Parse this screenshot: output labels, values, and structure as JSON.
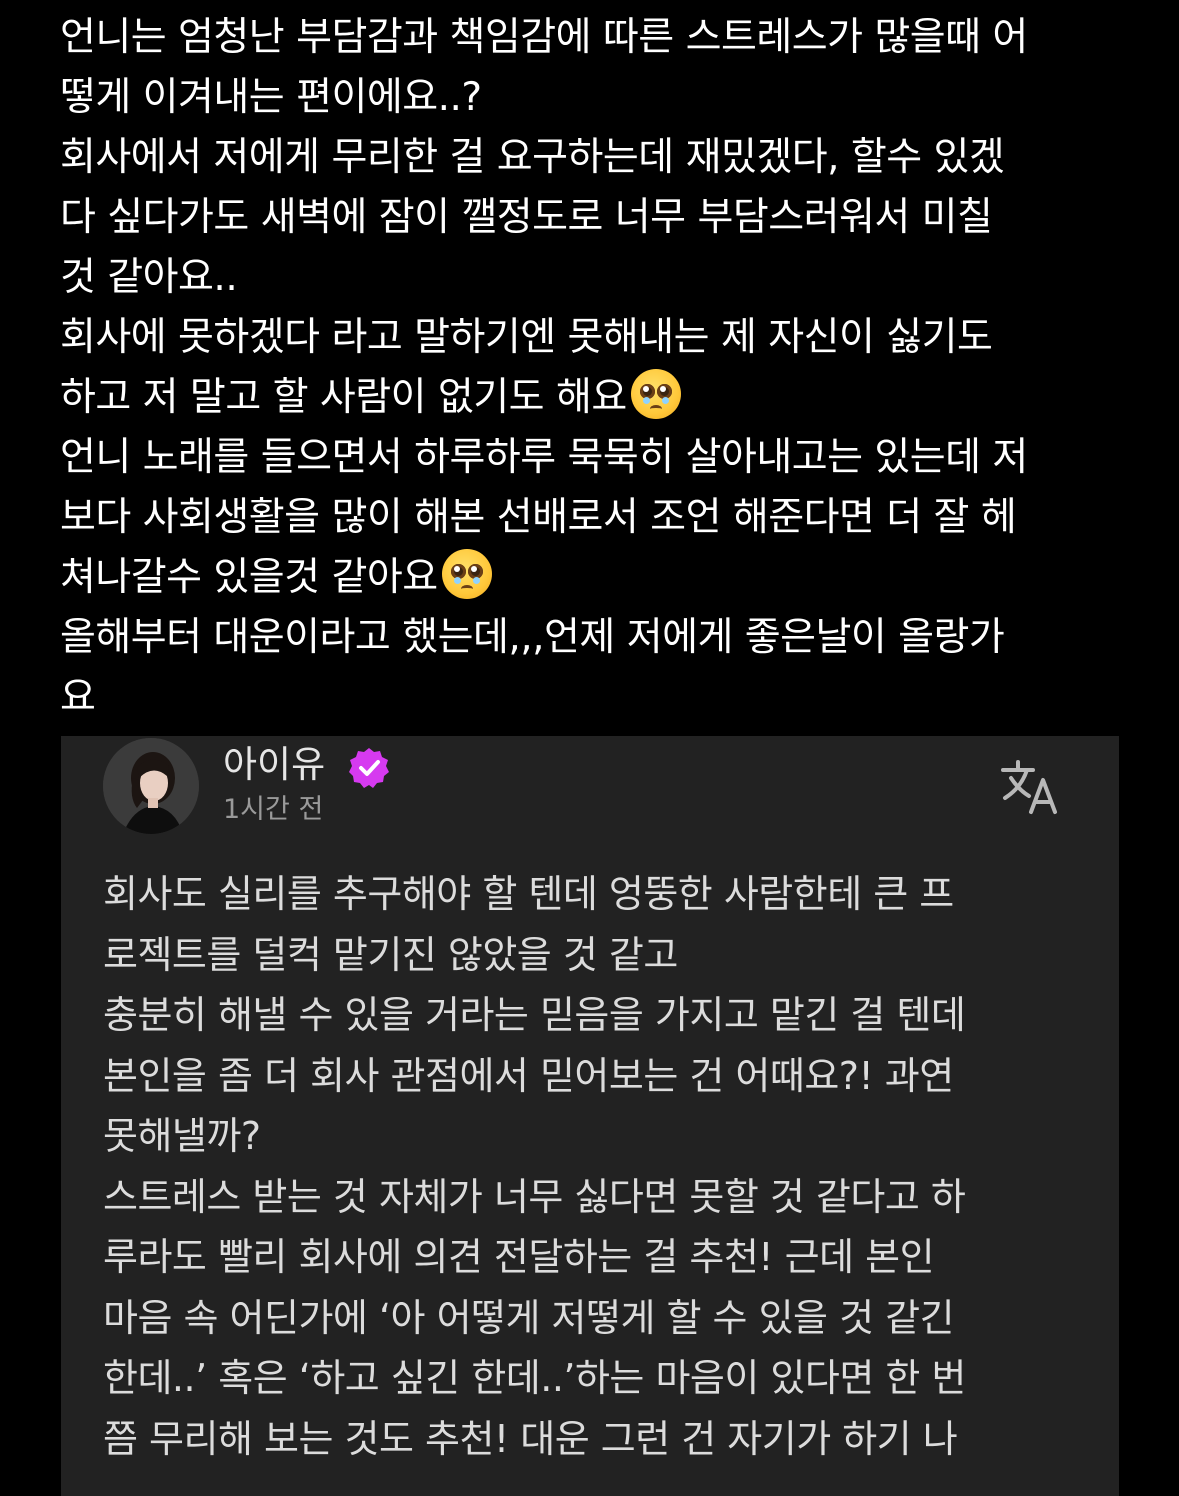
{
  "question": {
    "line1": "언니는 엄청난 부담감과 책임감에 따른 스트레스가 많을때 어",
    "line2": "떻게 이겨내는 편이에요..?",
    "line3": "회사에서 저에게 무리한 걸 요구하는데 재밌겠다, 할수 있겠",
    "line4": "다 싶다가도 새벽에 잠이 깰정도로 너무 부담스러워서 미칠",
    "line5": "것 같아요..",
    "line6": "회사에 못하겠다 라고 말하기엔 못해내는 제 자신이 싫기도",
    "line7": "하고 저 말고 할 사람이 없기도 해요",
    "line8": "언니 노래를 들으면서 하루하루 묵묵히 살아내고는 있는데 저",
    "line9": "보다 사회생활을 많이 해본 선배로서 조언 해준다면 더 잘 헤",
    "line10": "쳐나갈수 있을것 같아요",
    "line11": "올해부터 대운이라고 했는데,,,언제 저에게 좋은날이 올랑가",
    "line12": "요",
    "emoji_icon": "pleading-face-emoji"
  },
  "reply": {
    "username": "아이유",
    "timestamp": "1시간 전",
    "verified_color": "#d63af0",
    "translate_icon": "translate-icon",
    "body": {
      "line1": "회사도 실리를 추구해야 할 텐데 엉뚱한 사람한테 큰 프",
      "line2": "로젝트를 덜컥 맡기진 않았을 것 같고",
      "line3": "충분히 해낼 수 있을 거라는 믿음을 가지고 맡긴 걸 텐데",
      "line4": "본인을 좀 더 회사 관점에서 믿어보는 건 어때요?! 과연",
      "line5": "못해낼까?",
      "line6": "스트레스 받는 것 자체가 너무 싫다면 못할 것 같다고 하",
      "line7": "루라도 빨리 회사에 의견 전달하는 걸 추천! 근데 본인",
      "line8": "마음 속 어딘가에 ‘아 어떻게 저떻게 할 수 있을 것 같긴",
      "line9": "한데..’ 혹은 ‘하고 싶긴 한데..’하는 마음이 있다면 한 번",
      "line10": "쯤 무리해 보는 것도 추천! 대운 그런 건 자기가 하기 나"
    }
  }
}
